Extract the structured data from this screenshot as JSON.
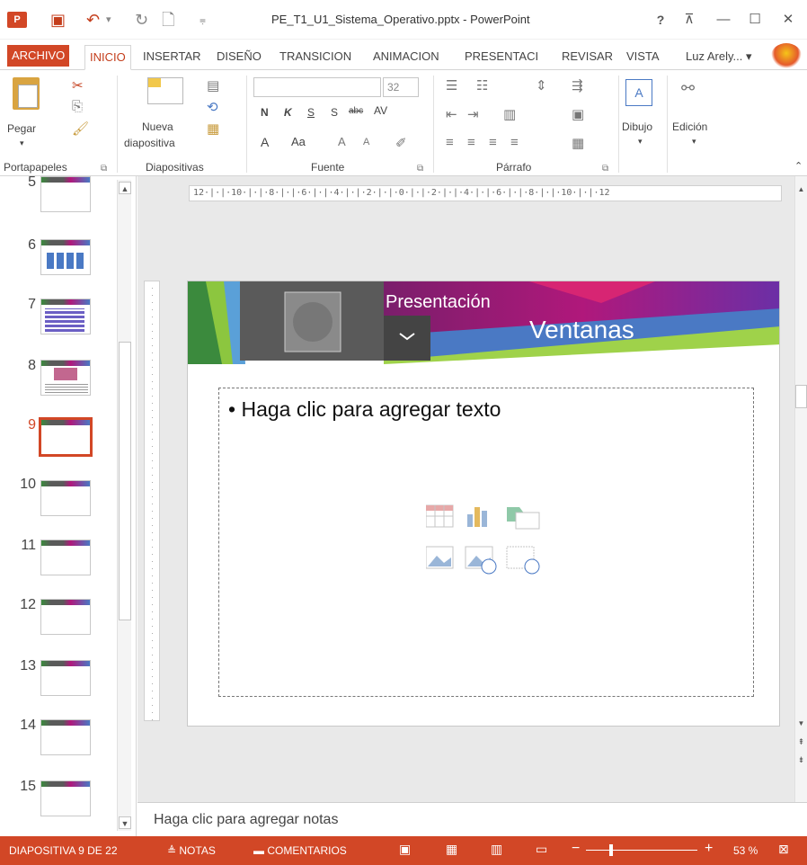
{
  "window": {
    "title": "PE_T1_U1_Sistema_Operativo.pptx - PowerPoint",
    "help": "?",
    "app_logo": "P⃞"
  },
  "tabs": [
    {
      "label": "ARCHIVO"
    },
    {
      "label": "INICIO"
    },
    {
      "label": "INSERTAR"
    },
    {
      "label": "DISEÑO"
    },
    {
      "label": "TRANSICION"
    },
    {
      "label": "ANIMACION"
    },
    {
      "label": "PRESENTACI"
    },
    {
      "label": "REVISAR"
    },
    {
      "label": "VISTA"
    }
  ],
  "user": {
    "name": "Luz Arely..."
  },
  "ribbon": {
    "portapapeles": {
      "group": "Portapapeles",
      "pegar": "Pegar"
    },
    "diapositivas": {
      "group": "Diapositivas",
      "nueva_line1": "Nueva",
      "nueva_line2": "diapositiva"
    },
    "fuente": {
      "group": "Fuente",
      "size": "32",
      "bold": "N",
      "italic": "K",
      "underline": "S",
      "shadow": "S",
      "strike": "abc",
      "spacing": "AV",
      "font_color": "A",
      "change_case": "Aa"
    },
    "parrafo": {
      "group": "Párrafo"
    },
    "dibujo": {
      "label": "Dibujo"
    },
    "edicion": {
      "label": "Edición"
    }
  },
  "thumbnails": [
    {
      "num": "5"
    },
    {
      "num": "6"
    },
    {
      "num": "7"
    },
    {
      "num": "8"
    },
    {
      "num": "9"
    },
    {
      "num": "10"
    },
    {
      "num": "11"
    },
    {
      "num": "12"
    },
    {
      "num": "13"
    },
    {
      "num": "14"
    },
    {
      "num": "15"
    }
  ],
  "rulers": {
    "horizontal": "12·|·|·10·|·|·8·|·|·6·|·|·4·|·|·2·|·|·0·|·|·2·|·|·4·|·|·6·|·|·8·|·|·10·|·|·12"
  },
  "slide": {
    "header_small": "Presentación",
    "header_large": "Ventanas",
    "body_placeholder": "Haga clic para agregar texto"
  },
  "notes": {
    "placeholder": "Haga clic para agregar notas"
  },
  "status": {
    "slide_info": "DIAPOSITIVA 9 DE 22",
    "notes": "NOTAS",
    "comments": "COMENTARIOS",
    "zoom": "53 %"
  },
  "colors": {
    "accent": "#d24726"
  }
}
